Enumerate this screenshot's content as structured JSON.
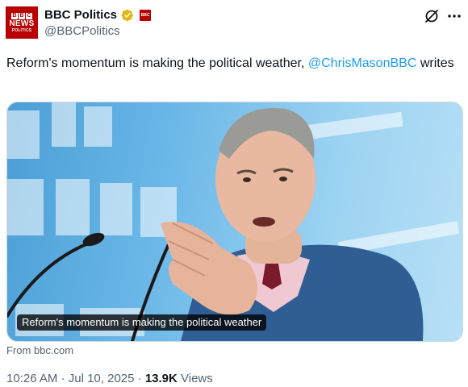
{
  "account": {
    "display_name": "BBC Politics",
    "handle": "@BBCPolitics",
    "avatar": {
      "line1": "B B C",
      "line2": "NEWS",
      "line3": "POLITICS"
    }
  },
  "tweet": {
    "text_before": "Reform's momentum is making the political weather, ",
    "mention": "@ChrisMasonBBC",
    "text_after": " writes"
  },
  "media": {
    "caption": "Reform's momentum is making the political weather",
    "source": "From bbc.com"
  },
  "meta": {
    "time": "10:26 AM",
    "separator1": "·",
    "date": "Jul 10, 2025",
    "separator2": "·",
    "views_count": "13.9K",
    "views_label": "Views"
  },
  "icons": {
    "verified": "verified-badge-icon",
    "affiliate": "bbc-affiliate-icon",
    "grok": "grok-icon",
    "more": "more-options-icon"
  },
  "colors": {
    "brand": "#b80000",
    "link": "#1d9bf0",
    "muted": "#536471",
    "verified": "#e2b719"
  }
}
